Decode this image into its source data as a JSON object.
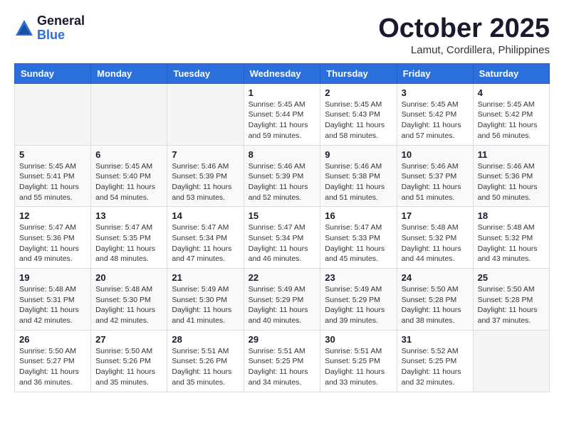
{
  "logo": {
    "general": "General",
    "blue": "Blue"
  },
  "title": "October 2025",
  "location": "Lamut, Cordillera, Philippines",
  "days_of_week": [
    "Sunday",
    "Monday",
    "Tuesday",
    "Wednesday",
    "Thursday",
    "Friday",
    "Saturday"
  ],
  "weeks": [
    [
      {
        "day": "",
        "info": ""
      },
      {
        "day": "",
        "info": ""
      },
      {
        "day": "",
        "info": ""
      },
      {
        "day": "1",
        "info": "Sunrise: 5:45 AM\nSunset: 5:44 PM\nDaylight: 11 hours\nand 59 minutes."
      },
      {
        "day": "2",
        "info": "Sunrise: 5:45 AM\nSunset: 5:43 PM\nDaylight: 11 hours\nand 58 minutes."
      },
      {
        "day": "3",
        "info": "Sunrise: 5:45 AM\nSunset: 5:42 PM\nDaylight: 11 hours\nand 57 minutes."
      },
      {
        "day": "4",
        "info": "Sunrise: 5:45 AM\nSunset: 5:42 PM\nDaylight: 11 hours\nand 56 minutes."
      }
    ],
    [
      {
        "day": "5",
        "info": "Sunrise: 5:45 AM\nSunset: 5:41 PM\nDaylight: 11 hours\nand 55 minutes."
      },
      {
        "day": "6",
        "info": "Sunrise: 5:45 AM\nSunset: 5:40 PM\nDaylight: 11 hours\nand 54 minutes."
      },
      {
        "day": "7",
        "info": "Sunrise: 5:46 AM\nSunset: 5:39 PM\nDaylight: 11 hours\nand 53 minutes."
      },
      {
        "day": "8",
        "info": "Sunrise: 5:46 AM\nSunset: 5:39 PM\nDaylight: 11 hours\nand 52 minutes."
      },
      {
        "day": "9",
        "info": "Sunrise: 5:46 AM\nSunset: 5:38 PM\nDaylight: 11 hours\nand 51 minutes."
      },
      {
        "day": "10",
        "info": "Sunrise: 5:46 AM\nSunset: 5:37 PM\nDaylight: 11 hours\nand 51 minutes."
      },
      {
        "day": "11",
        "info": "Sunrise: 5:46 AM\nSunset: 5:36 PM\nDaylight: 11 hours\nand 50 minutes."
      }
    ],
    [
      {
        "day": "12",
        "info": "Sunrise: 5:47 AM\nSunset: 5:36 PM\nDaylight: 11 hours\nand 49 minutes."
      },
      {
        "day": "13",
        "info": "Sunrise: 5:47 AM\nSunset: 5:35 PM\nDaylight: 11 hours\nand 48 minutes."
      },
      {
        "day": "14",
        "info": "Sunrise: 5:47 AM\nSunset: 5:34 PM\nDaylight: 11 hours\nand 47 minutes."
      },
      {
        "day": "15",
        "info": "Sunrise: 5:47 AM\nSunset: 5:34 PM\nDaylight: 11 hours\nand 46 minutes."
      },
      {
        "day": "16",
        "info": "Sunrise: 5:47 AM\nSunset: 5:33 PM\nDaylight: 11 hours\nand 45 minutes."
      },
      {
        "day": "17",
        "info": "Sunrise: 5:48 AM\nSunset: 5:32 PM\nDaylight: 11 hours\nand 44 minutes."
      },
      {
        "day": "18",
        "info": "Sunrise: 5:48 AM\nSunset: 5:32 PM\nDaylight: 11 hours\nand 43 minutes."
      }
    ],
    [
      {
        "day": "19",
        "info": "Sunrise: 5:48 AM\nSunset: 5:31 PM\nDaylight: 11 hours\nand 42 minutes."
      },
      {
        "day": "20",
        "info": "Sunrise: 5:48 AM\nSunset: 5:30 PM\nDaylight: 11 hours\nand 42 minutes."
      },
      {
        "day": "21",
        "info": "Sunrise: 5:49 AM\nSunset: 5:30 PM\nDaylight: 11 hours\nand 41 minutes."
      },
      {
        "day": "22",
        "info": "Sunrise: 5:49 AM\nSunset: 5:29 PM\nDaylight: 11 hours\nand 40 minutes."
      },
      {
        "day": "23",
        "info": "Sunrise: 5:49 AM\nSunset: 5:29 PM\nDaylight: 11 hours\nand 39 minutes."
      },
      {
        "day": "24",
        "info": "Sunrise: 5:50 AM\nSunset: 5:28 PM\nDaylight: 11 hours\nand 38 minutes."
      },
      {
        "day": "25",
        "info": "Sunrise: 5:50 AM\nSunset: 5:28 PM\nDaylight: 11 hours\nand 37 minutes."
      }
    ],
    [
      {
        "day": "26",
        "info": "Sunrise: 5:50 AM\nSunset: 5:27 PM\nDaylight: 11 hours\nand 36 minutes."
      },
      {
        "day": "27",
        "info": "Sunrise: 5:50 AM\nSunset: 5:26 PM\nDaylight: 11 hours\nand 35 minutes."
      },
      {
        "day": "28",
        "info": "Sunrise: 5:51 AM\nSunset: 5:26 PM\nDaylight: 11 hours\nand 35 minutes."
      },
      {
        "day": "29",
        "info": "Sunrise: 5:51 AM\nSunset: 5:25 PM\nDaylight: 11 hours\nand 34 minutes."
      },
      {
        "day": "30",
        "info": "Sunrise: 5:51 AM\nSunset: 5:25 PM\nDaylight: 11 hours\nand 33 minutes."
      },
      {
        "day": "31",
        "info": "Sunrise: 5:52 AM\nSunset: 5:25 PM\nDaylight: 11 hours\nand 32 minutes."
      },
      {
        "day": "",
        "info": ""
      }
    ]
  ]
}
